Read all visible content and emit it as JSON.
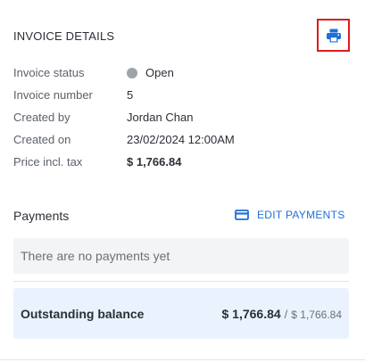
{
  "invoice_details": {
    "title": "INVOICE DETAILS",
    "print_icon": "printer-icon",
    "rows": [
      {
        "label": "Invoice status",
        "value": "Open",
        "status_color": "#9ea3a8"
      },
      {
        "label": "Invoice number",
        "value": "5"
      },
      {
        "label": "Created by",
        "value": "Jordan Chan"
      },
      {
        "label": "Created on",
        "value": "23/02/2024 12:00AM"
      },
      {
        "label": "Price incl. tax",
        "value": "$ 1,766.84"
      }
    ]
  },
  "payments": {
    "title": "Payments",
    "edit_label": "EDIT PAYMENTS",
    "edit_icon": "credit-card-icon",
    "empty_text": "There are no payments yet"
  },
  "balance": {
    "label": "Outstanding balance",
    "amount": "$ 1,766.84",
    "separator": "/",
    "total": "$ 1,766.84"
  },
  "colors": {
    "accent": "#1f6fd6",
    "highlight_border": "#e01b1b",
    "balance_bg": "#eaf3fd",
    "empty_bg": "#f3f4f5"
  }
}
